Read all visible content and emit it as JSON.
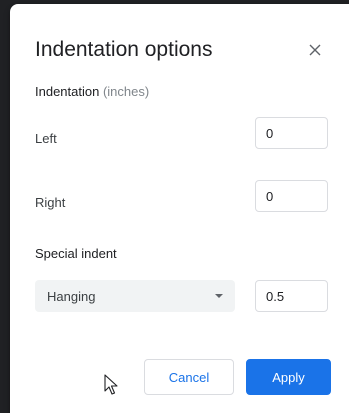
{
  "dialog": {
    "title": "Indentation options",
    "close_icon": "close-icon"
  },
  "indentation": {
    "heading": "Indentation",
    "heading_sub": "(inches)",
    "left_label": "Left",
    "left_value": "0",
    "right_label": "Right",
    "right_value": "0"
  },
  "special": {
    "heading": "Special indent",
    "selected": "Hanging",
    "value": "0.5"
  },
  "actions": {
    "cancel_label": "Cancel",
    "apply_label": "Apply"
  },
  "colors": {
    "accent": "#1a73e8",
    "text": "#202124",
    "muted": "#80868b"
  }
}
